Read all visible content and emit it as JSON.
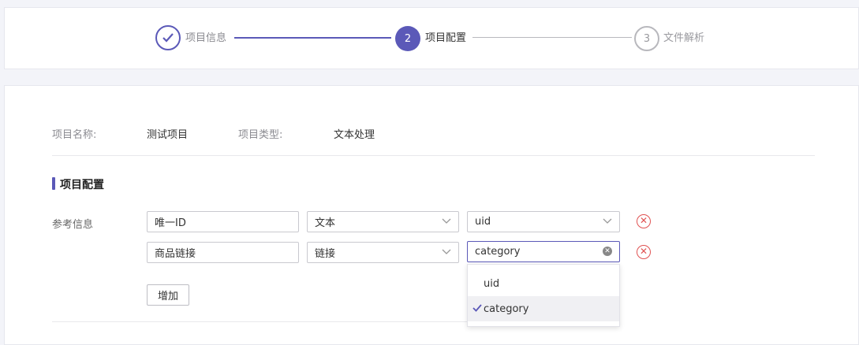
{
  "steps": [
    {
      "number": "",
      "label": "项目信息",
      "state": "done"
    },
    {
      "number": "2",
      "label": "项目配置",
      "state": "active"
    },
    {
      "number": "3",
      "label": "文件解析",
      "state": "todo"
    }
  ],
  "project_info": {
    "name_label": "项目名称:",
    "name_value": "测试项目",
    "type_label": "项目类型:",
    "type_value": "文本处理"
  },
  "section": {
    "title": "项目配置"
  },
  "reference": {
    "label": "参考信息",
    "rows": [
      {
        "name": "唯一ID",
        "type": "文本",
        "field": "uid"
      },
      {
        "name": "商品链接",
        "type": "链接",
        "field": "category"
      }
    ]
  },
  "add_button": "增加",
  "dropdown": {
    "options": [
      {
        "label": "uid",
        "selected": false
      },
      {
        "label": "category",
        "selected": true
      }
    ]
  },
  "colors": {
    "accent": "#5b59b8",
    "remove": "#e05252"
  }
}
